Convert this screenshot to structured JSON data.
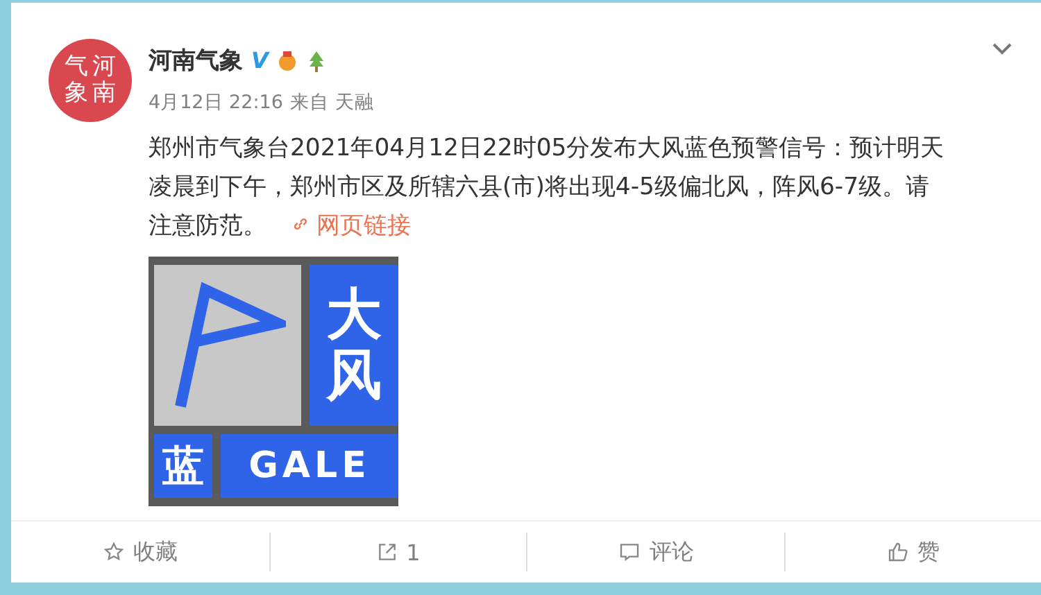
{
  "post": {
    "avatar": {
      "characters": [
        "气",
        "河",
        "象",
        "南"
      ]
    },
    "author": "河南气象",
    "badges": [
      "V"
    ],
    "time": "4月12日 22:16",
    "source": "来自 天融",
    "text": "郑州市气象台2021年04月12日22时05分发布大风蓝色预警信号：预计明天凌晨到下午，郑州市区及所辖六县(市)将出现4-5级偏北风，阵风6-7级。请注意防范。",
    "link": "网页链接",
    "sign": {
      "title": "大风",
      "level": "蓝",
      "english": "GALE"
    }
  },
  "actions": [
    {
      "kind": "favorite",
      "label": "收藏"
    },
    {
      "kind": "repost",
      "label": "1"
    },
    {
      "kind": "comment",
      "label": "评论"
    },
    {
      "kind": "like",
      "label": "赞"
    }
  ]
}
